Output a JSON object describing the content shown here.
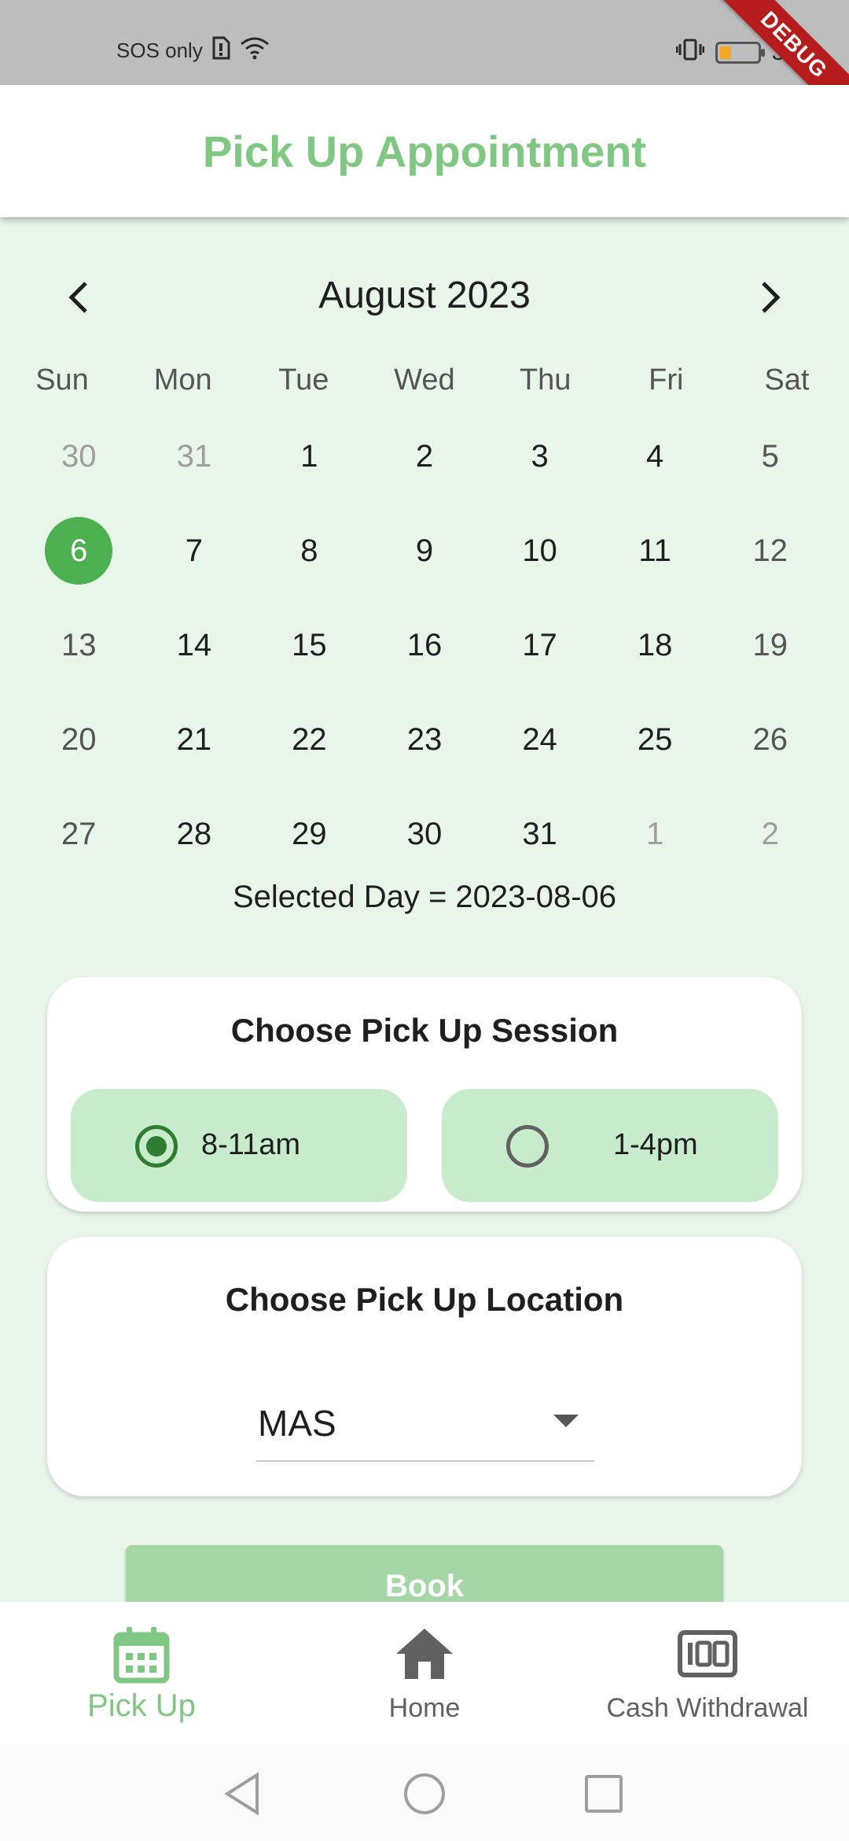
{
  "status_bar": {
    "carrier_text": "SOS only",
    "time": "3:42",
    "debug_label": "DEBUG"
  },
  "app_bar": {
    "title": "Pick Up Appointment"
  },
  "calendar": {
    "month_title": "August 2023",
    "weekdays": [
      "Sun",
      "Mon",
      "Tue",
      "Wed",
      "Thu",
      "Fri",
      "Sat"
    ],
    "weeks": [
      [
        "30",
        "31",
        "1",
        "2",
        "3",
        "4",
        "5"
      ],
      [
        "6",
        "7",
        "8",
        "9",
        "10",
        "11",
        "12"
      ],
      [
        "13",
        "14",
        "15",
        "16",
        "17",
        "18",
        "19"
      ],
      [
        "20",
        "21",
        "22",
        "23",
        "24",
        "25",
        "26"
      ],
      [
        "27",
        "28",
        "29",
        "30",
        "31",
        "1",
        "2"
      ]
    ],
    "selected_day_text": "Selected Day = 2023-08-06"
  },
  "session": {
    "title": "Choose Pick Up Session",
    "options": [
      {
        "label": "8-11am",
        "selected": true
      },
      {
        "label": "1-4pm",
        "selected": false
      }
    ]
  },
  "location": {
    "title": "Choose Pick Up Location",
    "selected_value": "MAS"
  },
  "book_button": {
    "label": "Book"
  },
  "bottom_nav": {
    "items": [
      {
        "label": "Pick Up",
        "icon": "calendar-icon",
        "active": true
      },
      {
        "label": "Home",
        "icon": "home-icon",
        "active": false
      },
      {
        "label": "Cash Withdrawal",
        "icon": "cash-icon",
        "active": false
      }
    ]
  },
  "colors": {
    "accent_green": "#81c784",
    "selected_day": "#4caf50",
    "background": "#e8f5e9",
    "option_bg": "#c8eccb",
    "button_bg": "#a5d6a7"
  }
}
